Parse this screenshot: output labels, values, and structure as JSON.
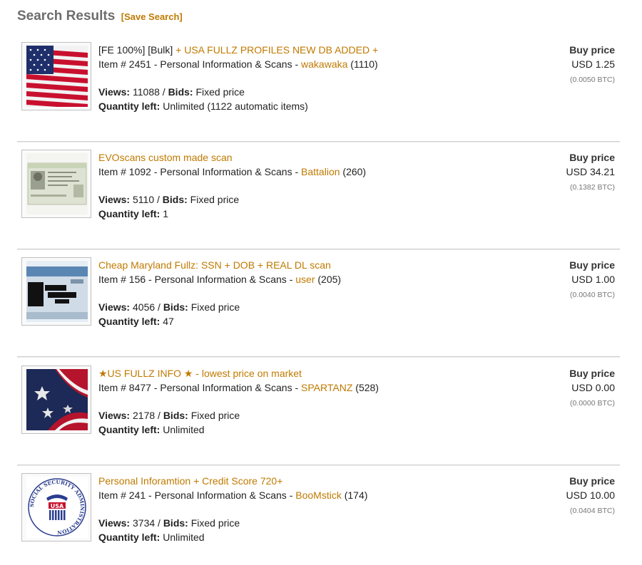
{
  "header": {
    "title": "Search Results",
    "save_label": "[Save Search]"
  },
  "listings": [
    {
      "prefix": "[FE 100%] [Bulk] ",
      "title": "+ USA FULLZ PROFILES NEW DB ADDED +",
      "item_label": "Item # 2451 - Personal Information & Scans - ",
      "seller": "wakawaka",
      "seller_score": " (1110)",
      "views_label": "Views:",
      "views": " 11088 / ",
      "bids_label": "Bids:",
      "bids": " Fixed price",
      "qty_label": "Quantity left:",
      "qty": " Unlimited (1122 automatic items)",
      "buy_label": "Buy price",
      "usd": "USD 1.25",
      "btc": "(0.0050 BTC)",
      "thumb_icon": "usa-flag-image"
    },
    {
      "prefix": "",
      "title": "EVOscans custom made scan",
      "item_label": "Item # 1092 - Personal Information & Scans - ",
      "seller": "Battalion",
      "seller_score": " (260)",
      "views_label": "Views:",
      "views": " 5110 / ",
      "bids_label": "Bids:",
      "bids": " Fixed price",
      "qty_label": "Quantity left:",
      "qty": " 1",
      "buy_label": "Buy price",
      "usd": "USD 34.21",
      "btc": "(0.1382 BTC)",
      "thumb_icon": "id-card-scan-image"
    },
    {
      "prefix": "",
      "title": "Cheap Maryland Fullz: SSN + DOB + REAL DL scan",
      "item_label": "Item # 156 - Personal Information & Scans - ",
      "seller": "user",
      "seller_score": " (205)",
      "views_label": "Views:",
      "views": " 4056 / ",
      "bids_label": "Bids:",
      "bids": " Fixed price",
      "qty_label": "Quantity left:",
      "qty": " 47",
      "buy_label": "Buy price",
      "usd": "USD 1.00",
      "btc": "(0.0040 BTC)",
      "thumb_icon": "redacted-license-image"
    },
    {
      "prefix": "",
      "title": "★US FULLZ INFO ★ - lowest price on market",
      "item_label": "Item # 8477 - Personal Information & Scans - ",
      "seller": "SPARTANZ",
      "seller_score": " (528)",
      "views_label": "Views:",
      "views": " 2178 / ",
      "bids_label": "Bids:",
      "bids": " Fixed price",
      "qty_label": "Quantity left:",
      "qty": " Unlimited",
      "buy_label": "Buy price",
      "usd": "USD 0.00",
      "btc": "(0.0000 BTC)",
      "thumb_icon": "flag-stars-image"
    },
    {
      "prefix": "",
      "title": "Personal Inforamtion + Credit Score 720+",
      "item_label": "Item # 241 - Personal Information & Scans - ",
      "seller": "BooMstick",
      "seller_score": " (174)",
      "views_label": "Views:",
      "views": " 3734 / ",
      "bids_label": "Bids:",
      "bids": " Fixed price",
      "qty_label": "Quantity left:",
      "qty": " Unlimited",
      "buy_label": "Buy price",
      "usd": "USD 10.00",
      "btc": "(0.0404 BTC)",
      "thumb_icon": "ssa-seal-image",
      "seal_text": "SOCIAL SECURITY ADMINISTRATION",
      "seal_usa": "USA"
    }
  ],
  "colors": {
    "link": "#c07a00",
    "title": "#6d6d6d"
  }
}
